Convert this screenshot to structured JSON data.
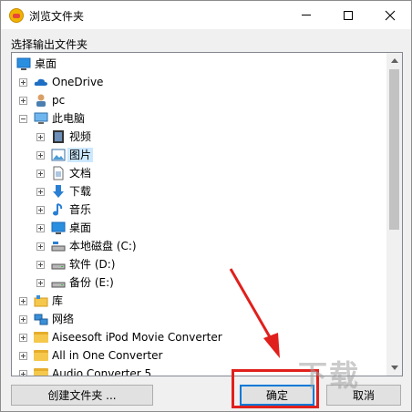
{
  "window": {
    "title": "浏览文件夹"
  },
  "dialog": {
    "prompt": "选择输出文件夹"
  },
  "tree": {
    "items": [
      {
        "label": "桌面",
        "icon": "desktop-icon",
        "depth": 0
      },
      {
        "label": "OneDrive",
        "icon": "cloud-icon",
        "depth": 1
      },
      {
        "label": "pc",
        "icon": "user-icon",
        "depth": 1
      },
      {
        "label": "此电脑",
        "icon": "computer-icon",
        "depth": 1
      },
      {
        "label": "视频",
        "icon": "video-icon",
        "depth": 2
      },
      {
        "label": "图片",
        "icon": "pictures-icon",
        "depth": 2,
        "selected": true
      },
      {
        "label": "文档",
        "icon": "documents-icon",
        "depth": 2
      },
      {
        "label": "下载",
        "icon": "download-icon",
        "depth": 2
      },
      {
        "label": "音乐",
        "icon": "music-icon",
        "depth": 2
      },
      {
        "label": "桌面",
        "icon": "desktop-icon",
        "depth": 2
      },
      {
        "label": "本地磁盘 (C:)",
        "icon": "drive-icon",
        "depth": 2
      },
      {
        "label": "软件 (D:)",
        "icon": "drive-icon",
        "depth": 2
      },
      {
        "label": "备份 (E:)",
        "icon": "drive-icon",
        "depth": 2
      },
      {
        "label": "库",
        "icon": "library-icon",
        "depth": 1
      },
      {
        "label": "网络",
        "icon": "network-icon",
        "depth": 1
      },
      {
        "label": "Aiseesoft iPod Movie Converter",
        "icon": "folder-icon",
        "depth": 1
      },
      {
        "label": "All in One Converter",
        "icon": "folder-icon",
        "depth": 1
      },
      {
        "label": "Audio Converter 5",
        "icon": "folder-icon",
        "depth": 1
      }
    ]
  },
  "buttons": {
    "create": "创建文件夹 ...",
    "ok": "确定",
    "cancel": "取消"
  },
  "colors": {
    "annotation": "#e0201c",
    "selection": "#cce8ff",
    "accent": "#0078d7"
  }
}
